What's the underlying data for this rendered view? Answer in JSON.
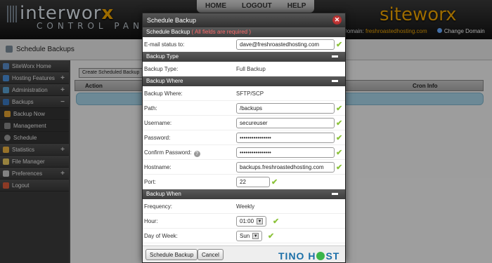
{
  "header": {
    "brand_left": "interwor",
    "brand_left_x": "x",
    "brand_left_sub": "CONTROL PANEL",
    "nav": [
      "HOME",
      "LOGOUT",
      "HELP"
    ],
    "brand_right": "siteworx",
    "domain_label": "Domain:",
    "domain_name": "freshroastedhosting.com",
    "change_domain": "Change Domain"
  },
  "page": {
    "title": "Schedule Backups"
  },
  "sidebar": {
    "items": [
      {
        "label": "SiteWorx Home",
        "pm": ""
      },
      {
        "label": "Hosting Features",
        "pm": "+"
      },
      {
        "label": "Administration",
        "pm": "+"
      },
      {
        "label": "Backups",
        "pm": "−"
      },
      {
        "label": "Backup Now",
        "pm": ""
      },
      {
        "label": "Management",
        "pm": ""
      },
      {
        "label": "Schedule",
        "pm": ""
      },
      {
        "label": "Statistics",
        "pm": "+"
      },
      {
        "label": "File Manager",
        "pm": ""
      },
      {
        "label": "Preferences",
        "pm": "+"
      },
      {
        "label": "Logout",
        "pm": ""
      }
    ]
  },
  "main": {
    "create_button": "Create Scheduled Backup",
    "columns": {
      "action": "Action",
      "cron": "Cron Info"
    }
  },
  "modal": {
    "title": "Schedule Backup",
    "close": "✕",
    "sections": {
      "main": "Schedule Backup",
      "required_note": "( All fields are required )",
      "type": "Backup Type",
      "where": "Backup Where",
      "when": "Backup When"
    },
    "fields": {
      "email_label": "E-mail status to:",
      "email_value": "dave@freshroastedhosting.com",
      "backup_type_label": "Backup Type:",
      "backup_type_value": "Full Backup",
      "backup_where_label": "Backup Where:",
      "backup_where_value": "SFTP/SCP",
      "path_label": "Path:",
      "path_value": "/backups",
      "username_label": "Username:",
      "username_value": "secureuser",
      "password_label": "Password:",
      "password_value": "••••••••••••••••",
      "confirm_label": "Confirm Password:",
      "confirm_value": "••••••••••••••••",
      "hostname_label": "Hostname:",
      "hostname_value": "backups.freshroastedhosting.com",
      "port_label": "Port:",
      "port_value": "22",
      "frequency_label": "Frequency:",
      "frequency_value": "Weekly",
      "hour_label": "Hour:",
      "hour_value": "01:00",
      "dow_label": "Day of Week:",
      "dow_value": "Sun"
    },
    "buttons": {
      "submit": "Schedule Backup",
      "cancel": "Cancel"
    }
  },
  "watermark": {
    "left": "TINO",
    "right": "ST"
  },
  "colors": {
    "accent": "#f0a500",
    "check": "#8cc33a",
    "row_highlight": "#a6d3e6"
  }
}
